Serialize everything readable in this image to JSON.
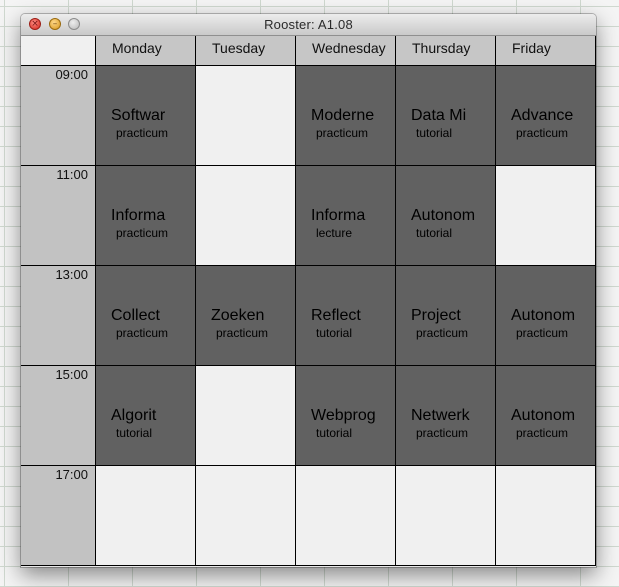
{
  "window": {
    "title": "Rooster: A1.08"
  },
  "icons": {
    "close": "close-icon",
    "minimize": "minimize-icon",
    "zoom": "zoom-icon"
  },
  "days": [
    "Monday",
    "Tuesday",
    "Wednesday",
    "Thursday",
    "Friday"
  ],
  "times": [
    "09:00",
    "11:00",
    "13:00",
    "15:00",
    "17:00"
  ],
  "schedule": [
    [
      {
        "course": "Softwar",
        "type": "practicum"
      },
      null,
      {
        "course": "Moderne",
        "type": "practicum"
      },
      {
        "course": "Data Mi",
        "type": "tutorial"
      },
      {
        "course": "Advance",
        "type": "practicum"
      }
    ],
    [
      {
        "course": "Informa",
        "type": "practicum"
      },
      null,
      {
        "course": "Informa",
        "type": "lecture"
      },
      {
        "course": "Autonom",
        "type": "tutorial"
      },
      null
    ],
    [
      {
        "course": "Collect",
        "type": "practicum"
      },
      {
        "course": "Zoeken",
        "type": "practicum"
      },
      {
        "course": "Reflect",
        "type": "tutorial"
      },
      {
        "course": "Project",
        "type": "practicum"
      },
      {
        "course": "Autonom",
        "type": "practicum"
      }
    ],
    [
      {
        "course": "Algorit",
        "type": "tutorial"
      },
      null,
      {
        "course": "Webprog",
        "type": "tutorial"
      },
      {
        "course": "Netwerk",
        "type": "practicum"
      },
      {
        "course": "Autonom",
        "type": "practicum"
      }
    ],
    [
      null,
      null,
      null,
      null,
      null
    ]
  ],
  "colors": {
    "filled": "#616161",
    "empty": "#f0f0f0",
    "header": "#c6c6c6",
    "timecol": "#c2c2c2"
  }
}
